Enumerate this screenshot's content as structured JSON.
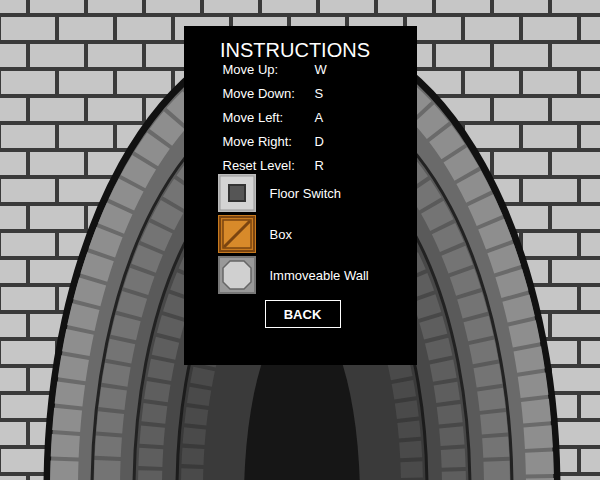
{
  "title": "INSTRUCTIONS",
  "controls": [
    {
      "label": "Move Up:",
      "key": "W"
    },
    {
      "label": "Move Down:",
      "key": "S"
    },
    {
      "label": "Move Left:",
      "key": "A"
    },
    {
      "label": "Move Right:",
      "key": "D"
    },
    {
      "label": "Reset Level:",
      "key": "R"
    }
  ],
  "legend": [
    {
      "label": "Floor Switch",
      "kind": "switch"
    },
    {
      "label": "Box",
      "kind": "box"
    },
    {
      "label": "Immoveable Wall",
      "kind": "wall"
    }
  ],
  "buttons": [
    "BACK"
  ]
}
